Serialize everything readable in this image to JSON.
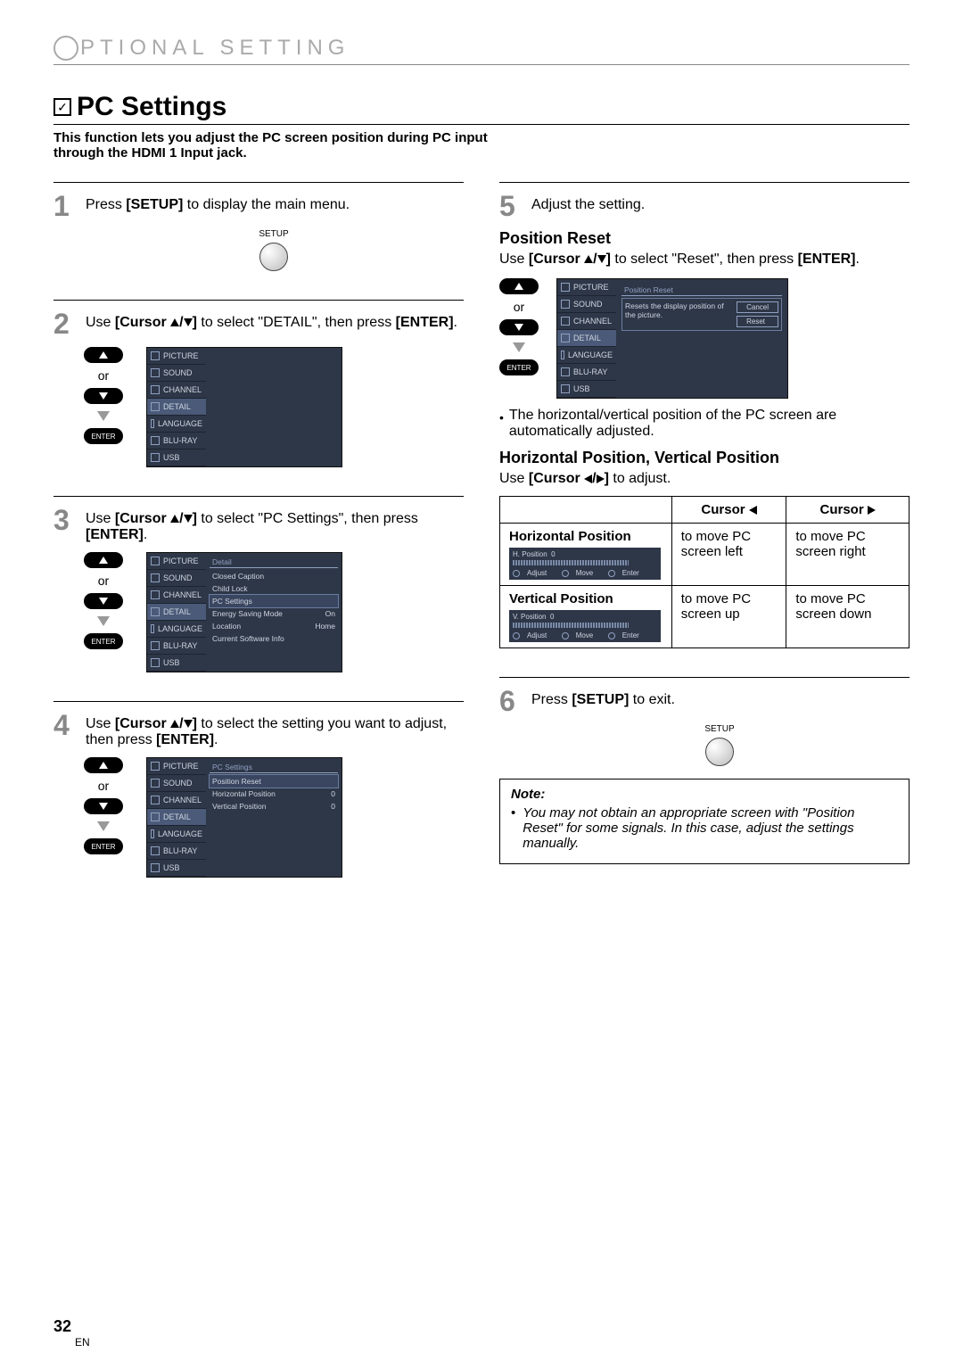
{
  "header": {
    "title": "PTIONAL   SETTING"
  },
  "section": {
    "title": "PC Settings",
    "desc": "This function lets you adjust the PC screen position during PC input through the HDMI 1 Input jack."
  },
  "remote": {
    "or": "or",
    "enter": "ENTER",
    "setup": "SETUP"
  },
  "menu": {
    "items": [
      "PICTURE",
      "SOUND",
      "CHANNEL",
      "DETAIL",
      "LANGUAGE",
      "BLU-RAY",
      "USB"
    ],
    "detail_title": "Detail",
    "detail_items": [
      "Closed Caption",
      "Child Lock",
      "PC Settings",
      "Energy Saving Mode",
      "Location",
      "Current Software Info"
    ],
    "detail_vals": {
      "energy": "On",
      "location": "Home"
    },
    "pcsettings_title": "PC Settings",
    "pcsettings_items": [
      "Position Reset",
      "Horizontal Position",
      "Vertical Position"
    ],
    "pcsettings_vals": {
      "h": "0",
      "v": "0"
    },
    "reset_title": "Position Reset",
    "reset_msg": "Resets the display position of the picture.",
    "reset_cancel": "Cancel",
    "reset_reset": "Reset",
    "mini": {
      "h_label": "H. Position",
      "v_label": "V. Position",
      "zero": "0",
      "adjust": "Adjust",
      "move": "Move",
      "enter": "Enter"
    }
  },
  "steps": {
    "1": {
      "pre": "Press ",
      "key": "[SETUP]",
      "post": " to display the main menu."
    },
    "2": {
      "pre": "Use ",
      "key": "[Cursor ",
      "post1": "/",
      "post2": "]",
      "rest": " to select \"DETAIL\", then press ",
      "enter": "[ENTER]",
      "dot": "."
    },
    "3": {
      "pre": "Use ",
      "key": "[Cursor ",
      "post1": "/",
      "post2": "]",
      "rest": " to select \"PC Settings\", then press ",
      "enter": "[ENTER]",
      "dot": "."
    },
    "4": {
      "pre": "Use ",
      "key": "[Cursor ",
      "post1": "/",
      "post2": "]",
      "rest": " to select the setting you want to adjust, then press ",
      "enter": "[ENTER]",
      "dot": "."
    },
    "5": {
      "text": "Adjust the setting."
    },
    "6": {
      "pre": "Press ",
      "key": "[SETUP]",
      "post": " to exit."
    }
  },
  "position_reset": {
    "h": "Position Reset",
    "line_pre": "Use ",
    "line_key": "[Cursor ",
    "line_mid": "/",
    "line_close": "]",
    "line_rest": " to select \"Reset\", then press ",
    "enter": "[ENTER]",
    "dot": ".",
    "bullet": "The horizontal/vertical position of the PC screen are automatically adjusted."
  },
  "hv": {
    "h": "Horizontal Position, Vertical Position",
    "line_pre": "Use ",
    "line_key": "[Cursor ",
    "line_mid": "/",
    "line_close": "]",
    "line_rest": " to adjust."
  },
  "table": {
    "col_left": "Cursor ",
    "col_right": "Cursor ",
    "row_h_label": "Horizontal Position",
    "row_h_left": "to move PC screen left",
    "row_h_right": "to move PC screen right",
    "row_v_label": "Vertical Position",
    "row_v_left": "to move PC screen up",
    "row_v_right": "to move PC screen down"
  },
  "note": {
    "title": "Note:",
    "item": "You may not obtain an appropriate screen with \"Position Reset\" for some signals. In this case, adjust the settings manually."
  },
  "page": {
    "num": "32",
    "lang": "EN"
  }
}
